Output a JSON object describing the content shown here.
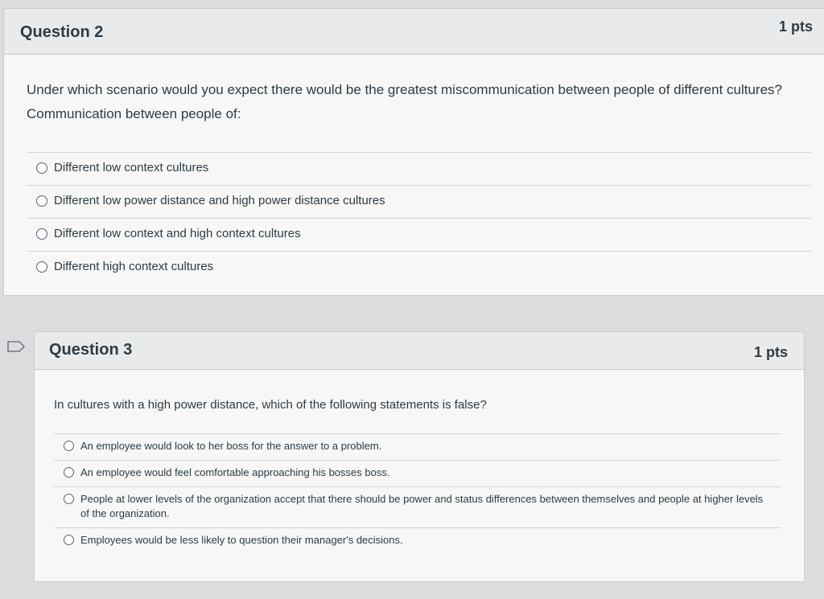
{
  "question2": {
    "title": "Question 2",
    "points": "1 pts",
    "text_line1": "Under which scenario would you expect there would be the greatest miscommunication between people of different cultures?",
    "text_line2": "Communication between people of:",
    "answers": [
      {
        "label": "Different low context cultures"
      },
      {
        "label": "Different low power distance and high power distance cultures"
      },
      {
        "label": "Different low context and high context cultures"
      },
      {
        "label": "Different high context cultures"
      }
    ]
  },
  "question3": {
    "title": "Question 3",
    "points": "1 pts",
    "text": "In cultures with a high power distance, which of the following statements is false?",
    "answers": [
      {
        "label": "An employee would look to her boss for the answer to a problem."
      },
      {
        "label": "An employee would feel comfortable approaching his bosses boss."
      },
      {
        "label": "People at lower levels of the organization accept that there should be power and status differences between themselves and people at higher levels of the organization."
      },
      {
        "label": "Employees would be less likely to question their manager's decisions."
      }
    ]
  },
  "icons": {
    "flag": "flag-question-icon",
    "radio": "radio-button-icon"
  },
  "colors": {
    "text": "#2d3b45",
    "border": "#c7cdd1",
    "header_bg": "#e9eaeb",
    "body_bg": "#f7f7f7"
  }
}
